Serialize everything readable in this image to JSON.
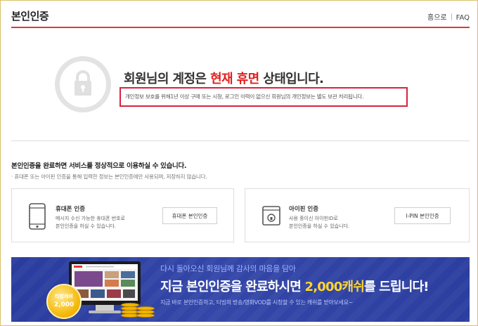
{
  "header": {
    "title": "본인인증",
    "nav": [
      "홈으로",
      "FAQ"
    ]
  },
  "dormant": {
    "title_prefix": "회원님의 계정은 ",
    "title_highlight": "현재 휴면",
    "title_suffix": " 상태입니다.",
    "notice": "개인정보 보호를 위해1년 이상 구매 또는 시청, 로그인 이력이 없으신 회원님의 개인정보는 별도 보관 처리됩니다."
  },
  "verification": {
    "heading": "본인인증을 완료하면 서비스를 정상적으로 이용하실 수 있습니다.",
    "subtext": "· 휴대폰 또는 아이핀 인증을 통해 입력한 정보는 본인인증에만 사용되며, 저장하지 않습니다.",
    "methods": [
      {
        "title": "휴대폰 인증",
        "desc": [
          "메시지 수신 가능한 휴대폰 번호로",
          "본인인증을 하실 수 있습니다."
        ],
        "button": "휴대폰 본인인증",
        "icon": "smartphone-icon"
      },
      {
        "title": "아이핀 인증",
        "desc": [
          "사용 중이신 아이핀ID로",
          "본인인증을 하실 수 있습니다."
        ],
        "button": "I-PIN 본인인증",
        "icon": "ipin-lock-icon"
      }
    ]
  },
  "banner": {
    "line1": "다시 돌아오신 회원님께 감사의 마음을 담아",
    "line2_prefix": "지금 본인인증을 완료하시면 ",
    "line2_highlight": "2,000캐쉬",
    "line2_suffix": "를 드립니다!",
    "line3": "지금 바로 본인인증하고, 티빙의 방송/영화VOD를 시청할 수 있는 캐쉬를 받아보세요~",
    "badge_line1": "티빙캐쉬",
    "badge_line2": "2,000"
  },
  "colors": {
    "accent_red": "#e02020",
    "banner_blue": "#3447a8",
    "banner_yellow": "#ffd52e"
  }
}
